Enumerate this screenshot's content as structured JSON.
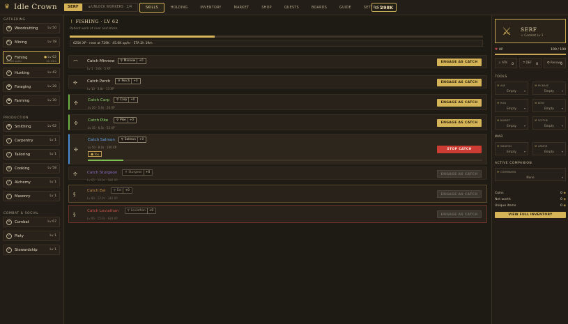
{
  "app": {
    "title": "Idle Crown",
    "rank_badge": "SERF",
    "unlock": "UNLOCK WORKERS · 2/4",
    "coins": "298K"
  },
  "nav": [
    "SKILLS",
    "HOLDING",
    "INVENTORY",
    "MARKET",
    "SHOP",
    "QUESTS",
    "BOARDS",
    "GUIDE",
    "SETTINGS"
  ],
  "sidebar": {
    "groups": [
      {
        "label": "GATHERING",
        "items": [
          {
            "name": "Woodcutting",
            "level": "Lv 50",
            "icon": "axe-icon",
            "glyph": "⚒"
          },
          {
            "name": "Mining",
            "level": "Lv 78",
            "icon": "pickaxe-icon",
            "glyph": "⛏"
          },
          {
            "name": "Fishing",
            "level": "Lv 62",
            "icon": "fish-icon",
            "glyph": "⌁",
            "active": true,
            "sub_left": "45.0K xp/hr",
            "sub_right": "2h 19m"
          },
          {
            "name": "Hunting",
            "level": "Lv 42",
            "icon": "bow-icon",
            "glyph": "➶"
          },
          {
            "name": "Foraging",
            "level": "Lv 28",
            "icon": "leaf-icon",
            "glyph": "❦"
          },
          {
            "name": "Farming",
            "level": "Lv 30",
            "icon": "wheat-icon",
            "glyph": "✿"
          }
        ]
      },
      {
        "label": "PRODUCTION",
        "items": [
          {
            "name": "Smithing",
            "level": "Lv 62",
            "icon": "anvil-icon",
            "glyph": "⚒"
          },
          {
            "name": "Carpentry",
            "level": "Lv 1",
            "icon": "saw-icon",
            "glyph": "/"
          },
          {
            "name": "Tailoring",
            "level": "Lv 1",
            "icon": "needle-icon",
            "glyph": "/"
          },
          {
            "name": "Cooking",
            "level": "Lv 58",
            "icon": "pot-icon",
            "glyph": "◎"
          },
          {
            "name": "Alchemy",
            "level": "Lv 1",
            "icon": "flask-icon",
            "glyph": "/"
          },
          {
            "name": "Masonry",
            "level": "Lv 1",
            "icon": "brick-icon",
            "glyph": "/"
          }
        ]
      },
      {
        "label": "COMBAT & SOCIAL",
        "items": [
          {
            "name": "Combat",
            "level": "Lv 67",
            "icon": "swords-icon",
            "glyph": "⚔"
          },
          {
            "name": "Piety",
            "level": "Lv 1",
            "icon": "prayer-icon",
            "glyph": "/"
          },
          {
            "name": "Stewardship",
            "level": "Lv 1",
            "icon": "scroll-icon",
            "glyph": "/"
          }
        ]
      }
    ]
  },
  "main": {
    "title": "FISHING · LV 62",
    "subtitle": "Patient work at river and shore.",
    "progress": 0.35,
    "status": "625K XP · next at 729K · 45.0K xp/hr · ETA 2h 19m",
    "actions": [
      {
        "name": "Catch Minnow",
        "item": "Minnow",
        "count": "+0",
        "meta": "Lv 1 · 3.0s · 5 XP",
        "button": "ENGAGE AS CATCH",
        "kind": "normal",
        "glyph": "⌒"
      },
      {
        "name": "Catch Perch",
        "item": "Perch",
        "count": "+0",
        "meta": "Lv 10 · 3.8s · 13 XP",
        "button": "ENGAGE AS CATCH",
        "kind": "normal",
        "glyph": "✣"
      },
      {
        "name": "Catch Carp",
        "item": "Carp",
        "count": "+0",
        "meta": "Lv 20 · 5.0s · 26 XP",
        "button": "ENGAGE AS CATCH",
        "kind": "carp",
        "glyph": "✣"
      },
      {
        "name": "Catch Pike",
        "item": "Pike",
        "count": "+0",
        "meta": "Lv 35 · 6.5s · 52 XP",
        "button": "ENGAGE AS CATCH",
        "kind": "carp",
        "glyph": "✣"
      },
      {
        "name": "Catch Salmon",
        "item": "Salmon",
        "count": "+0",
        "meta": "Lv 50 · 8.0s · 100 XP",
        "button": "STOP CATCH",
        "kind": "salmon",
        "glyph": "✣",
        "you": "You",
        "progress": 0.09
      },
      {
        "name": "Catch Sturgeon",
        "item": "Sturgeon",
        "count": "+0",
        "meta": "Lv 65 · 10.0s · 180 XP",
        "button": "ENGAGE AS CATCH",
        "kind": "locked stur",
        "glyph": "✣"
      },
      {
        "name": "Catch Eel",
        "item": "Eel",
        "count": "+0",
        "meta": "Lv 80 · 12.0s · 340 XP",
        "button": "ENGAGE AS CATCH",
        "kind": "locked eel",
        "glyph": "§"
      },
      {
        "name": "Catch Leviathan",
        "item": "Leviathan",
        "count": "+0",
        "meta": "Lv 95 · 15.0s · 620 XP",
        "button": "ENGAGE AS CATCH",
        "kind": "locked lev",
        "glyph": "§"
      }
    ]
  },
  "player": {
    "rank": "SERF",
    "class": "⚔ Combat Lv 1",
    "hp_label": "HP",
    "hp": "100 / 100",
    "hp_fraction": 1.0,
    "stats": [
      {
        "label": "ATK",
        "value": "0"
      },
      {
        "label": "DEF",
        "value": "0"
      },
      {
        "label": "Renown",
        "value": "0"
      }
    ],
    "tools_label": "TOOLS",
    "tools": [
      {
        "key": "AXE",
        "value": "Empty"
      },
      {
        "key": "PICKAXE",
        "value": "Empty"
      },
      {
        "key": "ROD",
        "value": "Empty"
      },
      {
        "key": "BOW",
        "value": "Empty"
      },
      {
        "key": "BASKET",
        "value": "Empty"
      },
      {
        "key": "SCYTHE",
        "value": "Empty"
      }
    ],
    "war_label": "WAR",
    "war": [
      {
        "key": "WEAPON",
        "value": "Empty"
      },
      {
        "key": "ARMOR",
        "value": "Empty"
      }
    ],
    "companion_label": "ACTIVE COMPANION",
    "companion": {
      "key": "COMPANION",
      "value": "None"
    },
    "summary": [
      {
        "label": "Coins",
        "value": "0"
      },
      {
        "label": "Net worth",
        "value": "0"
      },
      {
        "label": "Unique items",
        "value": "0"
      }
    ],
    "inventory_button": "VIEW FULL INVENTORY"
  },
  "colors": {
    "accent": "#d5b457",
    "background": "#1e1a14",
    "stop": "#cd3c33",
    "green": "#8ed56a",
    "blue": "#66a7ef"
  }
}
